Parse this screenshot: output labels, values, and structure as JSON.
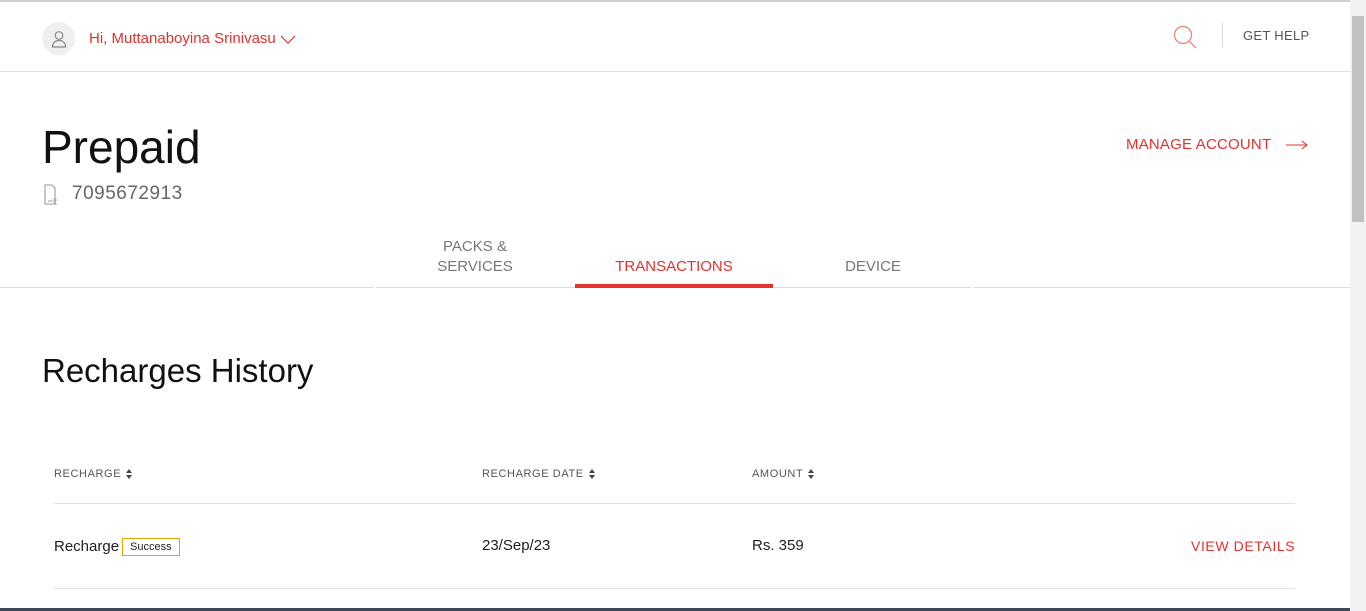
{
  "header": {
    "greeting": "Hi, Muttanaboyina Srinivasu",
    "get_help": "GET HELP"
  },
  "account": {
    "type": "Prepaid",
    "number": "7095672913",
    "manage_account": "MANAGE ACCOUNT"
  },
  "tabs": [
    {
      "line1": "PACKS &",
      "line2": "SERVICES"
    },
    {
      "label": "TRANSACTIONS",
      "active": true
    },
    {
      "label": "DEVICE"
    }
  ],
  "history": {
    "title": "Recharges History",
    "columns": [
      "RECHARGE",
      "RECHARGE DATE",
      "AMOUNT"
    ],
    "rows": [
      {
        "type": "Recharge",
        "status": "Success",
        "date": "23/Sep/23",
        "amount": "Rs. 359",
        "action": "VIEW DETAILS"
      }
    ]
  },
  "colors": {
    "accent": "#e1322d",
    "badge_border": "#e0a800"
  },
  "icons": [
    "user-icon",
    "chevron-down-icon",
    "search-icon",
    "sim-rupee-icon",
    "arrow-right-icon",
    "sort-icon"
  ]
}
